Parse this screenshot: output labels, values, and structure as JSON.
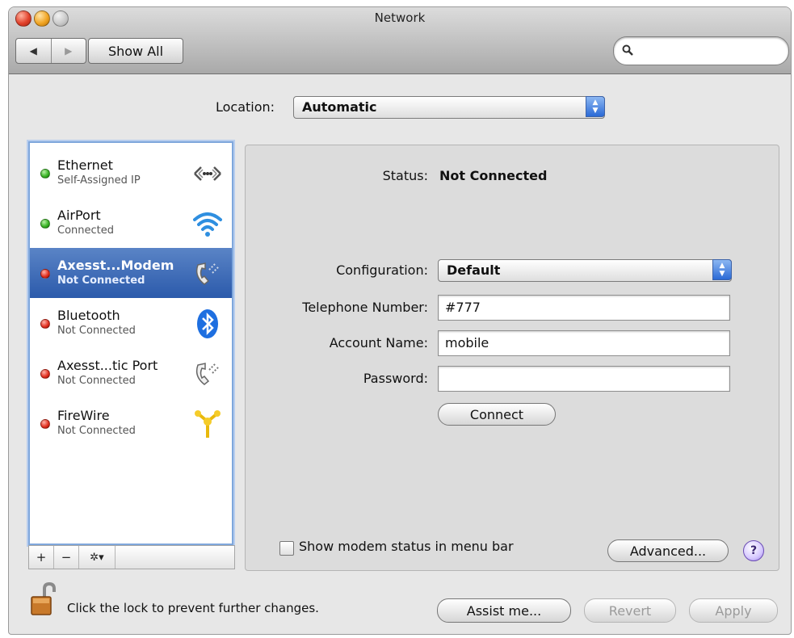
{
  "window": {
    "title": "Network"
  },
  "toolbar": {
    "back_glyph": "◀",
    "forward_glyph": "▶",
    "show_all_label": "Show All",
    "search_placeholder": "",
    "search_icon": "search-icon"
  },
  "location": {
    "label": "Location:",
    "value": "Automatic"
  },
  "services": [
    {
      "name": "Ethernet",
      "status": "Self-Assigned IP",
      "dot": "green",
      "icon": "ethernet-icon",
      "selected": false
    },
    {
      "name": "AirPort",
      "status": "Connected",
      "dot": "green",
      "icon": "airport-wifi-icon",
      "selected": false
    },
    {
      "name": "Axesst...Modem",
      "status": "Not Connected",
      "dot": "red",
      "icon": "phone-modem-icon",
      "selected": true
    },
    {
      "name": "Bluetooth",
      "status": "Not Connected",
      "dot": "red",
      "icon": "bluetooth-icon",
      "selected": false
    },
    {
      "name": "Axesst...tic Port",
      "status": "Not Connected",
      "dot": "red",
      "icon": "phone-modem-icon",
      "selected": false
    },
    {
      "name": "FireWire",
      "status": "Not Connected",
      "dot": "red",
      "icon": "firewire-icon",
      "selected": false
    }
  ],
  "sidebar_footer": {
    "add": "+",
    "remove": "−",
    "action": "✲▾"
  },
  "detail": {
    "status_label": "Status:",
    "status_value": "Not Connected",
    "configuration_label": "Configuration:",
    "configuration_value": "Default",
    "telephone_label": "Telephone Number:",
    "telephone_value": "#777",
    "account_label": "Account Name:",
    "account_value": "mobile",
    "password_label": "Password:",
    "password_value": "",
    "connect_label": "Connect",
    "show_modem_status_label": "Show modem status in menu bar",
    "show_modem_status_checked": false,
    "advanced_label": "Advanced...",
    "help_glyph": "?"
  },
  "bottom": {
    "lock_text": "Click the lock to prevent further changes.",
    "assist_label": "Assist me...",
    "revert_label": "Revert",
    "apply_label": "Apply"
  },
  "colors": {
    "selection": "#2f5fb0",
    "status_red": "#e02b1b",
    "status_green": "#34b020"
  }
}
